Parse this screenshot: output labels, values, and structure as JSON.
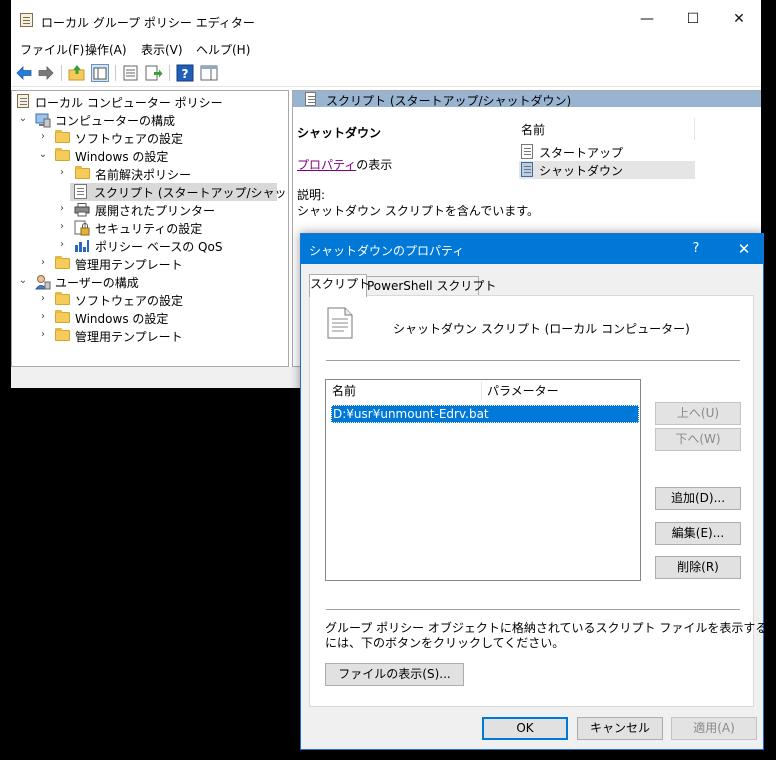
{
  "main_window": {
    "title": "ローカル グループ ポリシー エディター",
    "caption": {
      "minimize": "—",
      "maximize": "☐",
      "close": "✕"
    },
    "menu": [
      {
        "label": "ファイル(F)"
      },
      {
        "label": "操作(A)"
      },
      {
        "label": "表示(V)"
      },
      {
        "label": "ヘルプ(H)"
      }
    ],
    "tree": [
      {
        "label": "ローカル コンピューター ポリシー"
      },
      {
        "label": "コンピューターの構成"
      },
      {
        "label": "ソフトウェアの設定"
      },
      {
        "label": "Windows の設定"
      },
      {
        "label": "名前解決ポリシー"
      },
      {
        "label": "スクリプト (スタートアップ/シャットダウン)"
      },
      {
        "label": "展開されたプリンター"
      },
      {
        "label": "セキュリティの設定"
      },
      {
        "label": "ポリシー ベースの QoS"
      },
      {
        "label": "管理用テンプレート"
      },
      {
        "label": "ユーザーの構成"
      },
      {
        "label": "ソフトウェアの設定"
      },
      {
        "label": "Windows の設定"
      },
      {
        "label": "管理用テンプレート"
      }
    ],
    "right_pane": {
      "header": "スクリプト (スタートアップ/シャットダウン)",
      "section_title": "シャットダウン",
      "properties_link": "プロパティ",
      "properties_suffix": "の表示",
      "description_label": "説明:",
      "description": "シャットダウン スクリプトを含んでいます。",
      "column_name": "名前",
      "items": [
        {
          "label": "スタートアップ"
        },
        {
          "label": "シャットダウン"
        }
      ]
    }
  },
  "dialog": {
    "title": "シャットダウンのプロパティ",
    "help": "?",
    "close": "✕",
    "tabs": [
      {
        "label": "スクリプト"
      },
      {
        "label": "PowerShell スクリプト"
      }
    ],
    "heading": "シャットダウン スクリプト (ローカル コンピューター)",
    "list": {
      "col_name": "名前",
      "col_params": "パラメーター",
      "rows": [
        {
          "name": "D:¥usr¥unmount-Edrv.bat",
          "params": ""
        }
      ]
    },
    "buttons": {
      "up": "上へ(U)",
      "down": "下へ(W)",
      "add": "追加(D)...",
      "edit": "編集(E)...",
      "remove": "削除(R)",
      "show_files": "ファイルの表示(S)...",
      "ok": "OK",
      "cancel": "キャンセル",
      "apply": "適用(A)"
    },
    "info_text_line1": "グループ ポリシー オブジェクトに格納されているスクリプト ファイルを表示する",
    "info_text_line2": "には、下のボタンをクリックしてください。"
  },
  "colors": {
    "accent": "#0078d7",
    "right_header": "#99b4d1",
    "folder": "#f5cb5b",
    "link": "#800080"
  }
}
